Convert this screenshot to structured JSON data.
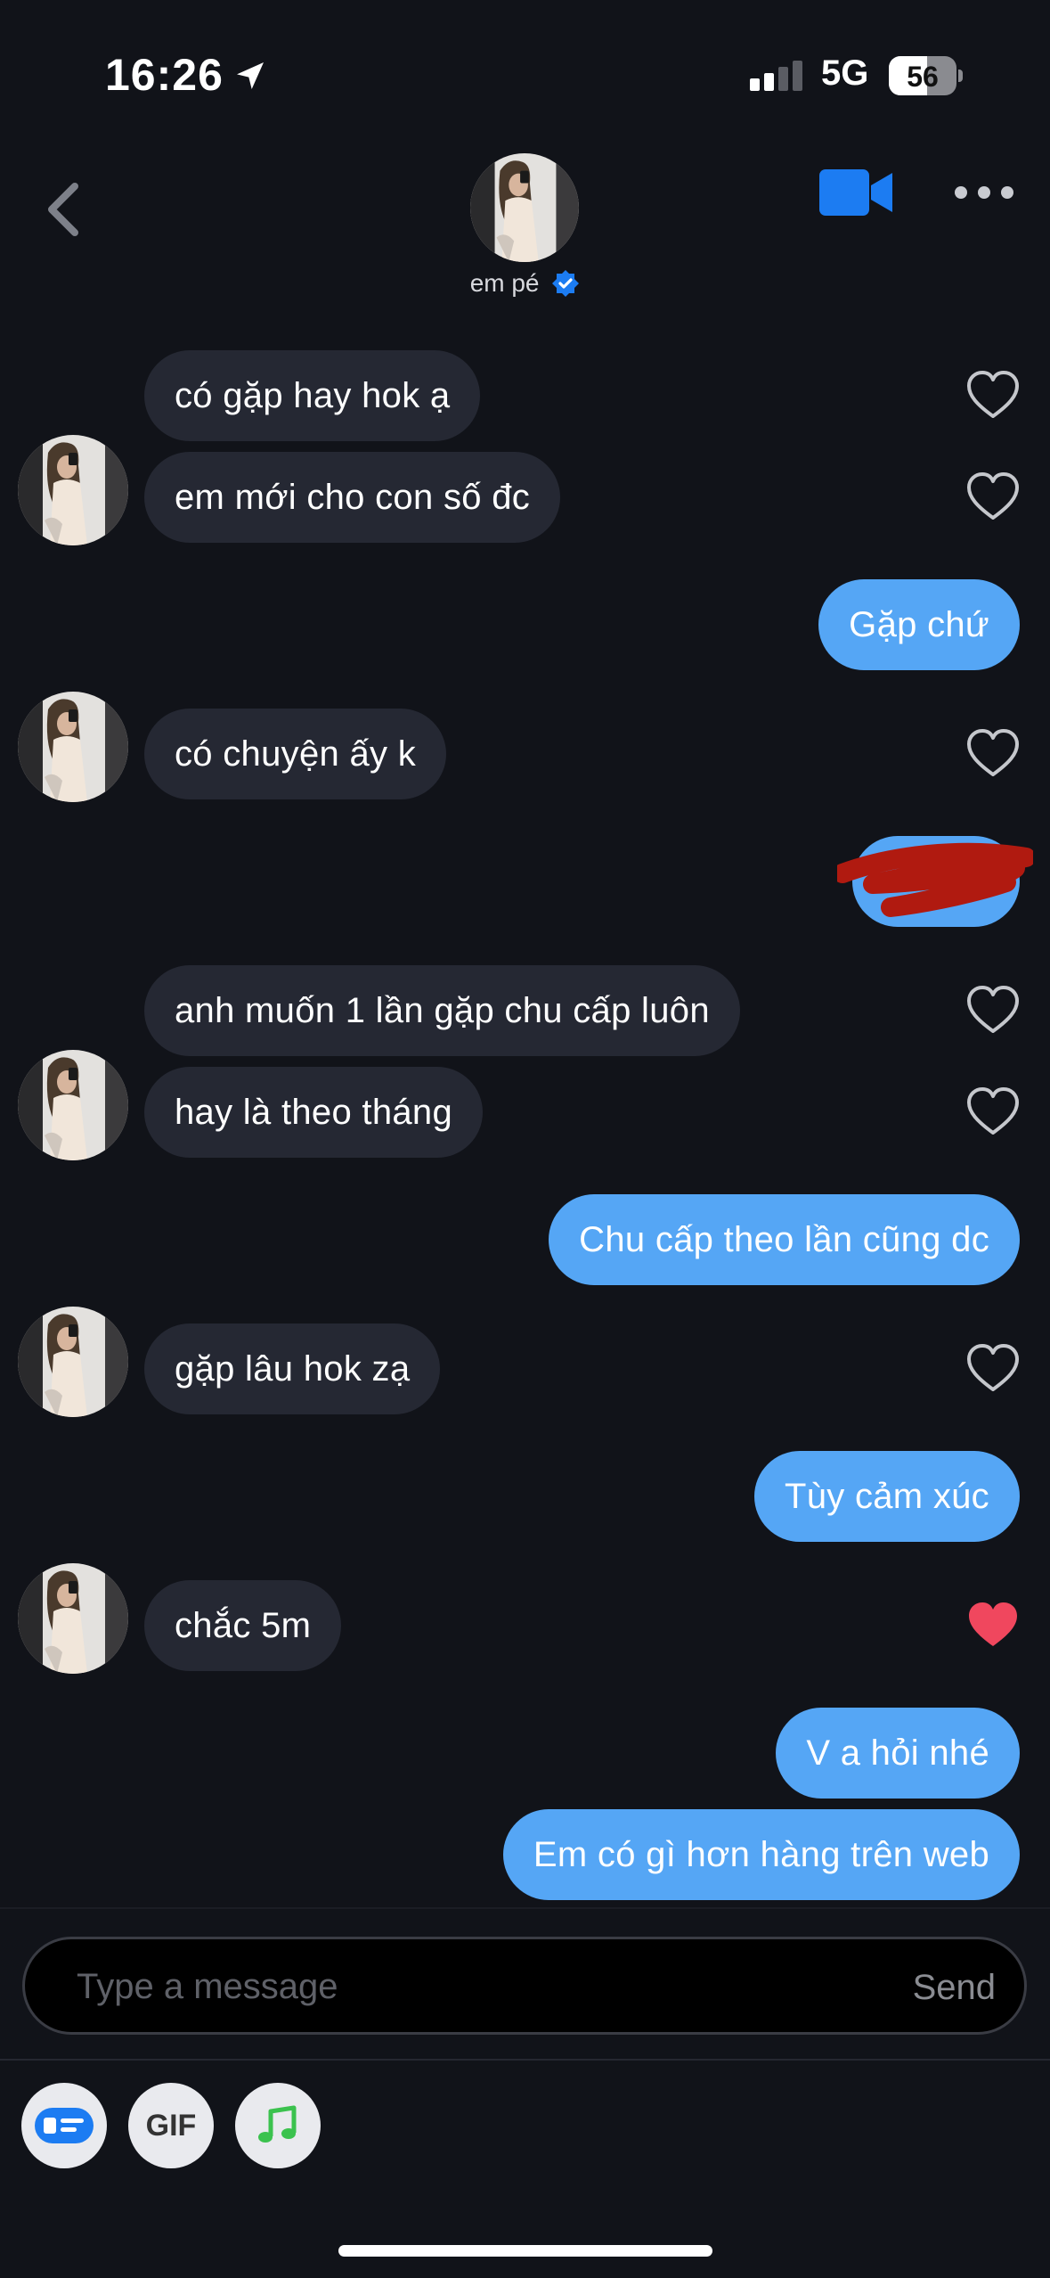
{
  "status_bar": {
    "time": "16:26",
    "network": "5G",
    "battery": "56",
    "battery_level": 0.56
  },
  "header": {
    "contact_name": "em pé"
  },
  "messages": [
    {
      "dir": "in",
      "text": "có gặp hay hok ạ",
      "liked": false
    },
    {
      "dir": "in",
      "text": "em mới cho con số đc",
      "liked": false
    },
    {
      "dir": "out",
      "text": "Gặp chứ"
    },
    {
      "dir": "in",
      "text": "có chuyện ấy k",
      "liked": false
    },
    {
      "dir": "out",
      "text": "",
      "redacted": true
    },
    {
      "dir": "in",
      "text": "anh muốn 1 lần gặp chu cấp luôn",
      "liked": false
    },
    {
      "dir": "in",
      "text": "hay là theo tháng",
      "liked": false
    },
    {
      "dir": "out",
      "text": "Chu cấp theo lần cũng dc"
    },
    {
      "dir": "in",
      "text": "gặp lâu hok zạ",
      "liked": false
    },
    {
      "dir": "out",
      "text": "Tùy cảm xúc"
    },
    {
      "dir": "in",
      "text": "chắc 5m",
      "liked": true
    },
    {
      "dir": "out",
      "text": "V a hỏi nhé"
    },
    {
      "dir": "out",
      "text": "Em có gì hơn hàng trên web"
    }
  ],
  "composer": {
    "placeholder": "Type a message",
    "send_label": "Send"
  },
  "toolbar": {
    "gif_label": "GIF"
  },
  "colors": {
    "background": "#111319",
    "incoming": "#252833",
    "outgoing": "#55a6f5",
    "accent": "#1c7cf2",
    "like": "#f0475e"
  }
}
